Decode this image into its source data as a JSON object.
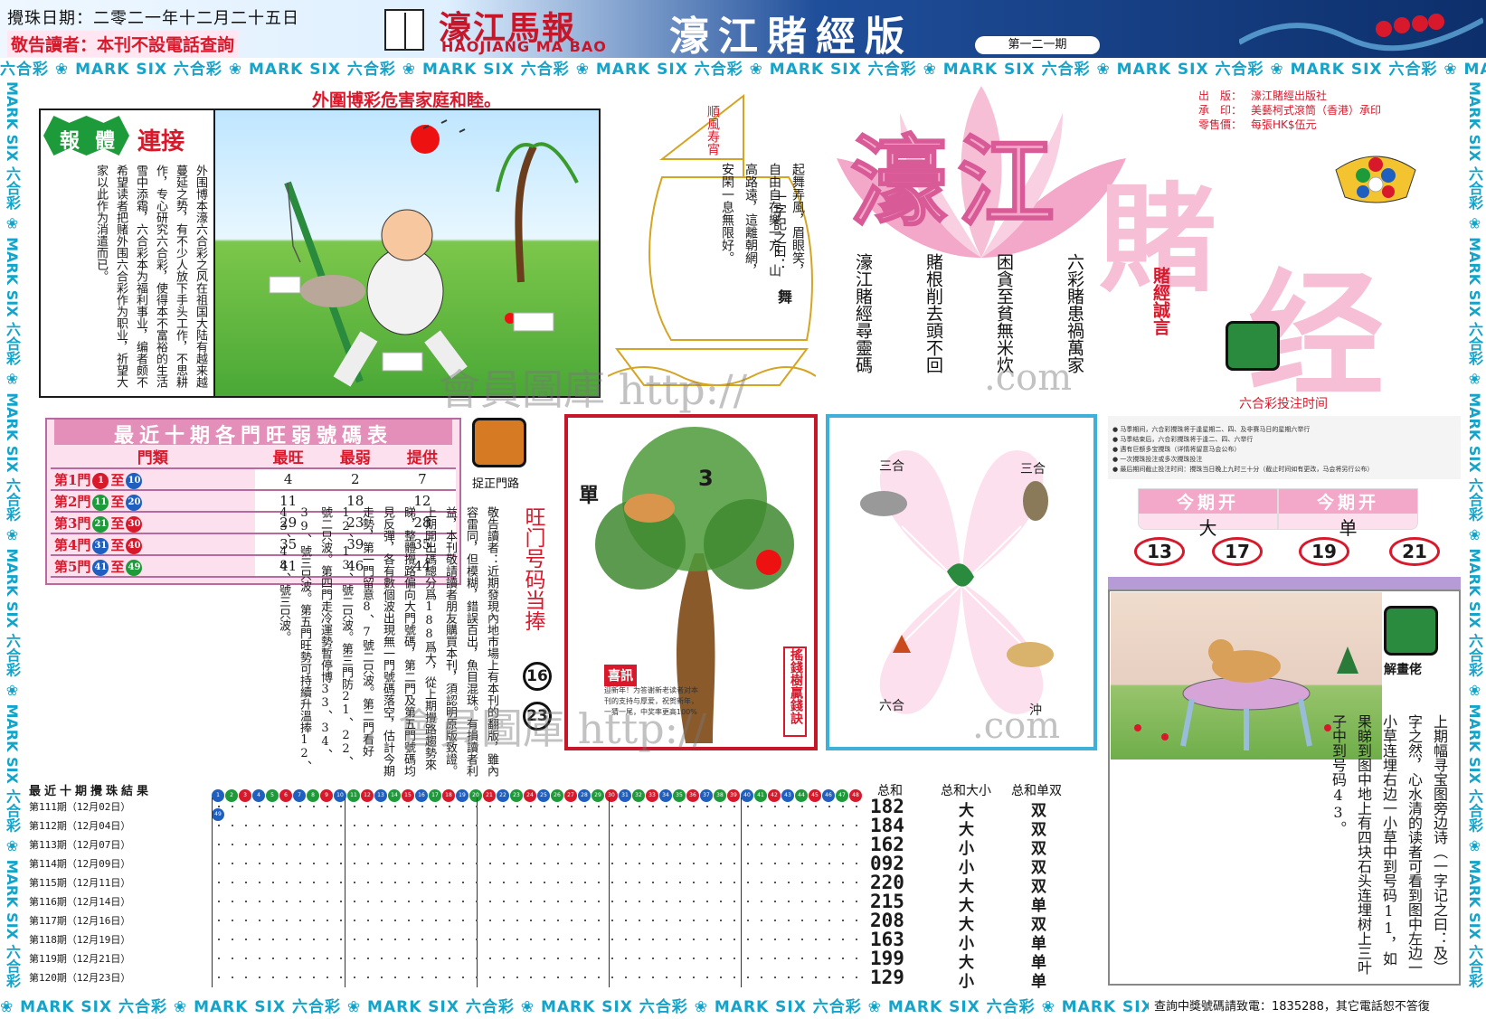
{
  "header": {
    "draw_date": "攪珠日期：二零二一年十二月二十五日",
    "notice": "敬告讀者：本刊不設電話查詢",
    "brand_cn": "濠江馬報",
    "brand_en": "HAOJIANG MA BAO",
    "edition": "濠江賭經版",
    "issue": "第一二一期"
  },
  "ribbon": {
    "top": "六合彩 ❀ MARK SIX 六合彩 ❀ MARK SIX 六合彩 ❀ MARK SIX 六合彩 ❀ MARK SIX 六合彩 ❀ MARK SIX 六合彩 ❀ MARK SIX 六合彩 ❀ MARK SIX 六合彩 ❀ MARK SIX 六合彩 ❀ MARK SIX 六合彩 ❀ MARK SIX",
    "side": "MARK SIX 六合彩 ❀ MARK SIX 六合彩 ❀ MARK SIX 六合彩 ❀ MARK SIX 六合彩 ❀ MARK SIX 六合彩 ❀ MARK SIX 六合彩 ❀",
    "bottom": "❀ MARK SIX 六合彩 ❀ MARK SIX 六合彩 ❀ MARK SIX 六合彩 ❀ MARK SIX 六合彩 ❀ MARK SIX 六合彩 ❀ MARK SIX 六合彩 ❀ MARK SIX 六合彩 ❀ MA"
  },
  "slogan": "外圍博彩危害家庭和睦。",
  "article": {
    "tag_a": "報",
    "tag_b": "體",
    "tag_c": "連接",
    "body": "外围博本濠六合彩之风在祖国大陆有越来越蔓延之势，有不少人放下手头工作，不思耕作，专心研究六合彩，使得本不富裕的生活雪中添霜，六合彩本为福利事业，编者颇不希望读者把赌外围六合彩作为职业，祈望大家以此作为消遣而已。"
  },
  "ship": {
    "flag": "順風寿宵",
    "title": "一字記之曰：",
    "title_word": "舞",
    "poem": "起舞弄風，眉眼笑，自由自在樂一方，山高路遠，這離朝網，安閑一息無限好。"
  },
  "title": {
    "jiang": "濠江",
    "du": "賭",
    "jing": "经"
  },
  "publisher": {
    "rows": [
      {
        "label": "出　版：",
        "value": "濠江賭經出版社"
      },
      {
        "label": "承　印：",
        "value": "美藝柯式滾筒（香港）承印"
      },
      {
        "label": "零售價：",
        "value": "每張HK$伍元"
      }
    ]
  },
  "proverbs": {
    "lines": [
      "六彩賭患禍萬家",
      "困貪至貧無米炊",
      "賭根削去頭不回",
      "濠江賭經尋靈碼"
    ]
  },
  "honest_words": "賭經誠言",
  "bet_time": {
    "title": "六合彩投注时间",
    "rules": [
      "● 马季期间，六合彩攪珠将于逢星期二、四、及非赛马日的星期六举行",
      "● 马季结束后，六合彩攪珠将于逢二、四、六举行",
      "● 遇有巨额多宝攪珠（详情将留意马会公布）",
      "● 一次攪珠投注或多次攪珠投注",
      "● 最后期间截止投注时间：攪珠当日晚上九时三十分（截止时间如有更改，马会将另行公布）"
    ]
  },
  "period": {
    "head_1": "今期开",
    "val_1": "大",
    "head_2": "今期开",
    "val_2": "单",
    "numbers": [
      "13",
      "17",
      "19",
      "21"
    ]
  },
  "table": {
    "title": "最近十期各門旺弱號碼表",
    "headers": [
      "門類",
      "最旺",
      "最弱",
      "提供"
    ],
    "rows": [
      {
        "gate": "第1門",
        "from": "1",
        "to": "10",
        "from_color": "#d8192c",
        "to_color": "#1f5fbf",
        "hot": "4",
        "cold": "2",
        "offer": "7"
      },
      {
        "gate": "第2門",
        "from": "11",
        "to": "20",
        "from_color": "#1d9b3a",
        "to_color": "#1f5fbf",
        "hot": "11",
        "cold": "18",
        "offer": "12"
      },
      {
        "gate": "第3門",
        "from": "21",
        "to": "30",
        "from_color": "#1d9b3a",
        "to_color": "#d8192c",
        "hot": "29",
        "cold": "23",
        "offer": "28"
      },
      {
        "gate": "第4門",
        "from": "31",
        "to": "40",
        "from_color": "#1f5fbf",
        "to_color": "#d8192c",
        "hot": "35",
        "cold": "39",
        "offer": "35"
      },
      {
        "gate": "第5門",
        "from": "41",
        "to": "49",
        "from_color": "#1f5fbf",
        "to_color": "#1d9b3a",
        "hot": "41",
        "cold": "46",
        "offer": "44"
      }
    ]
  },
  "gate": {
    "label": "捉正門路",
    "title": "旺门号码当捧",
    "numbers": [
      "16",
      "23"
    ]
  },
  "long_article": "敬告讀者：近期發現內地市場上有本刊的翻版，雖內容雷同，但模糊，錯誤百出，魚目混珠。有損讀者利益，本刊敬請讀者朋友購買本刊，須認明原版致證。上期開出碼總分爲188爲大，從上期攪路趨勢來睇，整體攪路偏向大門號碼，第二門及第五門號碼均見反彈，各有數個波出現無一門號碼落空，估計今期走勢，第一門留意8、7號二只波。第二門看好12、13、號二只波。第三門防21、22、號二只波。第四門走冷運勢暫停博33、34、39、號三只波。第五門旺勢可持續升溫捧12、43、48、號三只波。",
  "tree_card": {
    "number": "3",
    "single": "單",
    "note_title": "喜訊",
    "note": "迎新年！为答谢新老读者对本刊的支持与厚爱，祝贺新年，一猜一尾，中奖率更高100%",
    "side": "搖錢樹贏錢訣"
  },
  "clover": {
    "tl": "三合",
    "tr": "三合",
    "bl": "六合",
    "br": "沖"
  },
  "riddle": {
    "label": "解畫佬",
    "text": "上期幅寻宝图旁边诗（一字记之曰：及）字之然，心水清的读者可看到图中左边一小草连埋右边一小草中到号码11，如果睇到图中地上有四块石头连埋树上三叶子中到号码43。"
  },
  "results": {
    "title": "最近十期攪珠結果",
    "col_sum": "总和",
    "col_size": "总和大小",
    "col_odd": "总和单双",
    "rows": [
      {
        "label": "第111期",
        "date": "（12月02日）",
        "sum": "182",
        "size": "大",
        "odd": "双"
      },
      {
        "label": "第112期",
        "date": "（12月04日）",
        "sum": "184",
        "size": "大",
        "odd": "双"
      },
      {
        "label": "第113期",
        "date": "（12月07日）",
        "sum": "162",
        "size": "小",
        "odd": "双"
      },
      {
        "label": "第114期",
        "date": "（12月09日）",
        "sum": "092",
        "size": "小",
        "odd": "双"
      },
      {
        "label": "第115期",
        "date": "（12月11日）",
        "sum": "220",
        "size": "大",
        "odd": "双"
      },
      {
        "label": "第116期",
        "date": "（12月14日）",
        "sum": "215",
        "size": "大",
        "odd": "单"
      },
      {
        "label": "第117期",
        "date": "（12月16日）",
        "sum": "208",
        "size": "大",
        "odd": "双"
      },
      {
        "label": "第118期",
        "date": "（12月19日）",
        "sum": "163",
        "size": "小",
        "odd": "单"
      },
      {
        "label": "第119期",
        "date": "（12月21日）",
        "sum": "199",
        "size": "大",
        "odd": "单"
      },
      {
        "label": "第120期",
        "date": "（12月23日）",
        "sum": "129",
        "size": "小",
        "odd": "单"
      }
    ]
  },
  "watermarks": {
    "w1": "會員圖庫 http://",
    "w2": ".com",
    "w3": "會員圖庫 http://",
    "w4": ".com"
  },
  "footer": {
    "contact": "查詢中獎號碼請致電：1835288，其它電話恕不答復"
  },
  "colors": {
    "red": "#d8192c",
    "teal": "#14a3c9",
    "pink": "#f6bfd6",
    "green": "#1d9b3a"
  }
}
